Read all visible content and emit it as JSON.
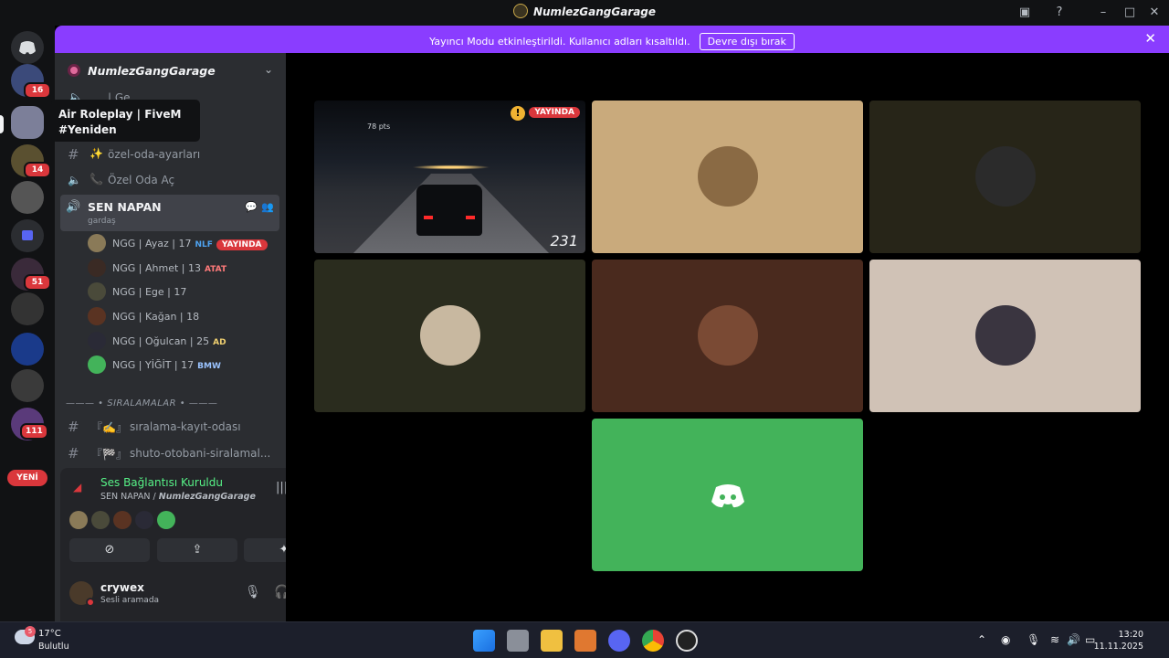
{
  "window": {
    "title": "NumlezGangGarage"
  },
  "banner": {
    "text": "Yayıncı Modu etkinleştirildi. Kullanıcı adları kısaltıldı.",
    "button": "Devre dışı bırak"
  },
  "servers": {
    "badges": [
      "16",
      "14",
      "51",
      "111"
    ],
    "new_label": "YENİ",
    "tooltip": {
      "line1": "Air Roleplay | FiveM",
      "line2": "#Yeniden"
    }
  },
  "guild": {
    "name": "NumlezGangGarage"
  },
  "channels": {
    "partial": "| Ge...",
    "ozel_oda_ayarlari": {
      "emoji": "✨",
      "label": "özel-oda-ayarları"
    },
    "ozel_oda_ac": {
      "label": "Özel Oda Aç"
    },
    "active": {
      "name": "SEN NAPAN",
      "sub": "gardaş"
    },
    "category": "——— • SIRALAMALAR • ———",
    "siralama_kayit": {
      "emoji": "『✍️』",
      "label": "sıralama-kayıt-odası"
    },
    "shuto": {
      "emoji": "『🏁』",
      "label": "shuto-otobani-siralamal..."
    }
  },
  "members": [
    {
      "name": "NGG | Ayaz | 17",
      "tag": "NLF",
      "live": "YAYINDA"
    },
    {
      "name": "NGG | Ahmet | 13",
      "tag": "ATAT"
    },
    {
      "name": "NGG | Ege | 17"
    },
    {
      "name": "NGG | Kağan | 18"
    },
    {
      "name": "NGG | Oğulcan | 25",
      "tag": "AD"
    },
    {
      "name": "NGG | YİĞİT | 17",
      "tag": "BMW"
    }
  ],
  "voice": {
    "status": "Ses Bağlantısı Kuruldu",
    "channel": "SEN NAPAN",
    "separator": "/",
    "server": "NumlezGangGarage"
  },
  "user": {
    "name": "crywex",
    "status": "Sesli aramada"
  },
  "stream": {
    "live": "YAYINDA",
    "speed": "231",
    "points": "78 pts"
  },
  "taskbar": {
    "temp": "17°C",
    "weather": "Bulutlu",
    "time": "13:20",
    "date": "11.11.2025",
    "weather_badge": "5"
  },
  "colors": {
    "accent": "#8a3dff",
    "live": "#da373c",
    "connected": "#57f287",
    "discord_tile": "#43b35a"
  }
}
